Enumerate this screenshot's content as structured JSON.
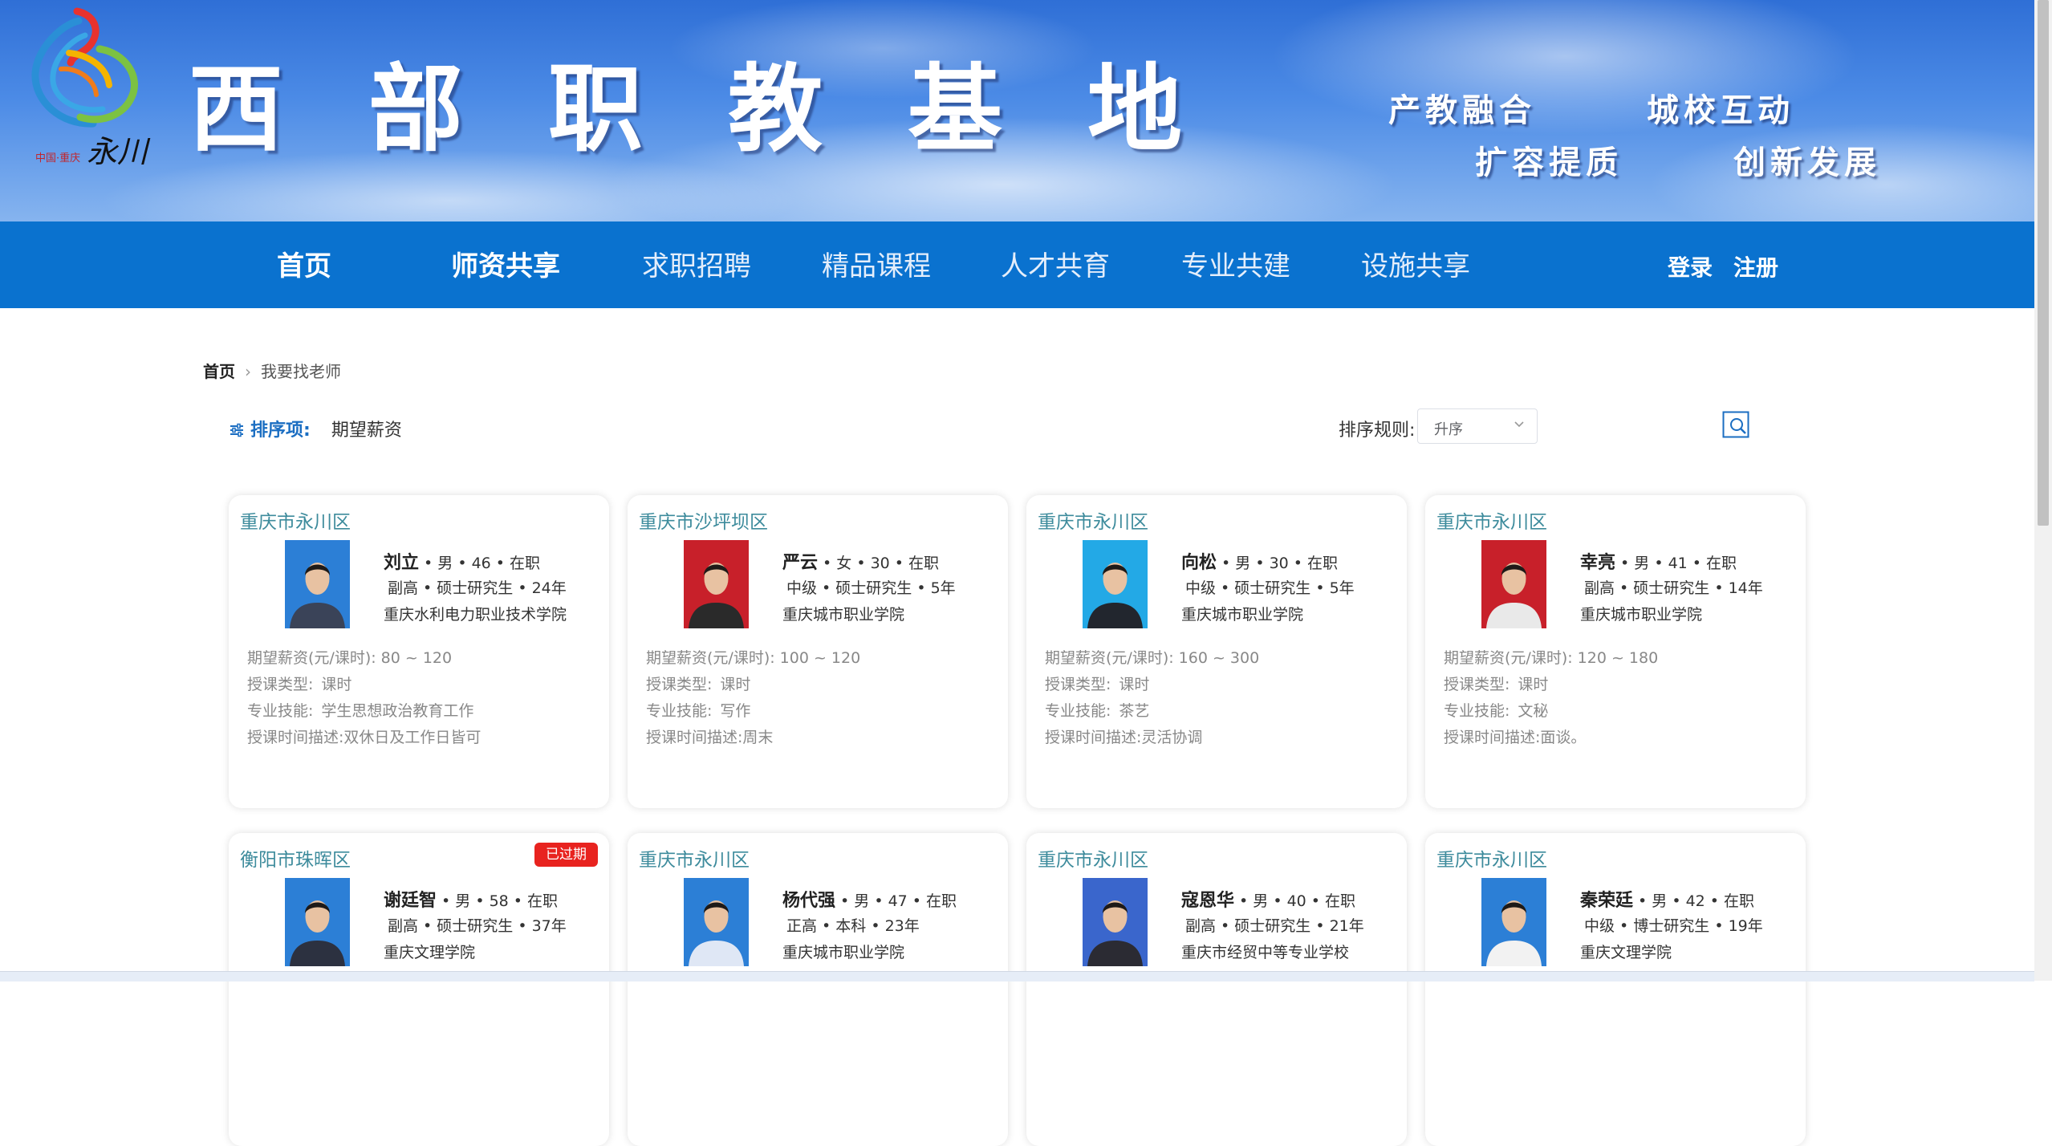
{
  "banner": {
    "title": "西部职教基地",
    "slogans": [
      "产教融合",
      "城校互动",
      "扩容提质",
      "创新发展"
    ],
    "logo_text_small": "中国·重庆",
    "logo_text_calligraphy": "永川"
  },
  "nav": {
    "items": [
      {
        "label": "首页",
        "active": true
      },
      {
        "label": "师资共享",
        "active": true
      },
      {
        "label": "求职招聘",
        "active": false
      },
      {
        "label": "精品课程",
        "active": false
      },
      {
        "label": "人才共育",
        "active": false
      },
      {
        "label": "专业共建",
        "active": false
      },
      {
        "label": "设施共享",
        "active": false
      }
    ],
    "login": "登录",
    "register": "注册"
  },
  "breadcrumb": {
    "home": "首页",
    "current": "我要找老师"
  },
  "filters": {
    "sort_item_label": "排序项:",
    "sort_item_value": "期望薪资",
    "sort_rule_label": "排序规则:",
    "sort_rule_value": "升序"
  },
  "labels": {
    "salary": "期望薪资(元/课时):",
    "type": "授课类型:",
    "skill": "专业技能:",
    "time": "授课时间描述:"
  },
  "teachers": [
    {
      "region": "重庆市永川区",
      "name": "刘立",
      "meta": " • 男 • 46 • 在职",
      "title_edu": "副高 • 硕士研究生 • 24年",
      "school": "重庆水利电力职业技术学院",
      "salary": "80 ~ 120",
      "type": "课时",
      "skill": "学生思想政治教育工作",
      "time": "双休日及工作日皆可",
      "badge": ""
    },
    {
      "region": "重庆市沙坪坝区",
      "name": "严云",
      "meta": " • 女 • 30 • 在职",
      "title_edu": "中级 • 硕士研究生 • 5年",
      "school": "重庆城市职业学院",
      "salary": "100 ~ 120",
      "type": "课时",
      "skill": "写作",
      "time": "周末",
      "badge": ""
    },
    {
      "region": "重庆市永川区",
      "name": "向松",
      "meta": " • 男 • 30 • 在职",
      "title_edu": "中级 • 硕士研究生 • 5年",
      "school": "重庆城市职业学院",
      "salary": "160 ~ 300",
      "type": "课时",
      "skill": "茶艺",
      "time": "灵活协调",
      "badge": ""
    },
    {
      "region": "重庆市永川区",
      "name": "幸亮",
      "meta": " • 男 • 41 • 在职",
      "title_edu": "副高 • 硕士研究生 • 14年",
      "school": "重庆城市职业学院",
      "salary": "120 ~ 180",
      "type": "课时",
      "skill": "文秘",
      "time": "面谈。",
      "badge": ""
    },
    {
      "region": "衡阳市珠晖区",
      "name": "谢廷智",
      "meta": " • 男 • 58 • 在职",
      "title_edu": "副高 • 硕士研究生 • 37年",
      "school": "重庆文理学院",
      "badge": "已过期"
    },
    {
      "region": "重庆市永川区",
      "name": "杨代强",
      "meta": " • 男 • 47 • 在职",
      "title_edu": "正高 • 本科 • 23年",
      "school": "重庆城市职业学院",
      "badge": ""
    },
    {
      "region": "重庆市永川区",
      "name": "寇恩华",
      "meta": " • 男 • 40 • 在职",
      "title_edu": "副高 • 硕士研究生 • 21年",
      "school": "重庆市经贸中等专业学校",
      "badge": ""
    },
    {
      "region": "重庆市永川区",
      "name": "秦荣廷",
      "meta": " • 男 • 42 • 在职",
      "title_edu": "中级 • 博士研究生 • 19年",
      "school": "重庆文理学院",
      "badge": ""
    }
  ],
  "colors": {
    "nav_bg": "#0a72cf",
    "region_text": "#3d8b9c",
    "accent": "#1b6ec2",
    "badge_bg": "#e8231f"
  },
  "icons": {
    "sort": "sliders-icon",
    "search": "search-icon",
    "breadcrumb_sep": "chevron-right-icon",
    "select": "chevron-down-icon"
  }
}
